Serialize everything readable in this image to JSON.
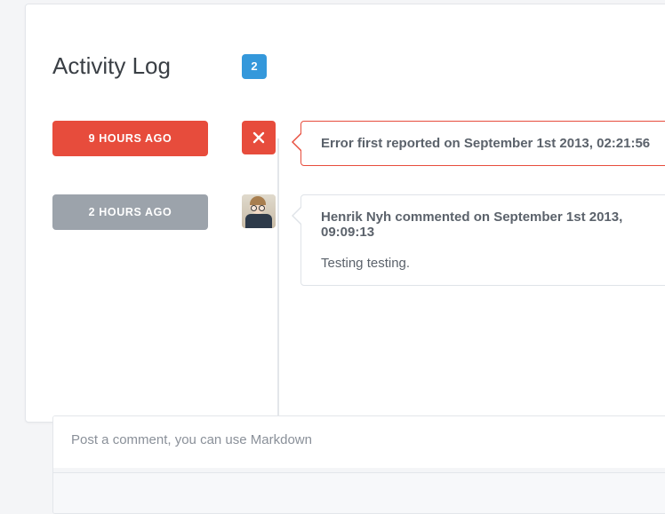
{
  "header": {
    "title": "Activity Log",
    "count": "2"
  },
  "entries": [
    {
      "time_label": "9 HOURS AGO",
      "headline": "Error first reported on September 1st 2013, 02:21:56"
    },
    {
      "time_label": "2 HOURS AGO",
      "headline": "Henrik Nyh commented on September 1st 2013, 09:09:13",
      "body": "Testing testing."
    }
  ],
  "compose": {
    "placeholder": "Post a comment, you can use Markdown"
  }
}
